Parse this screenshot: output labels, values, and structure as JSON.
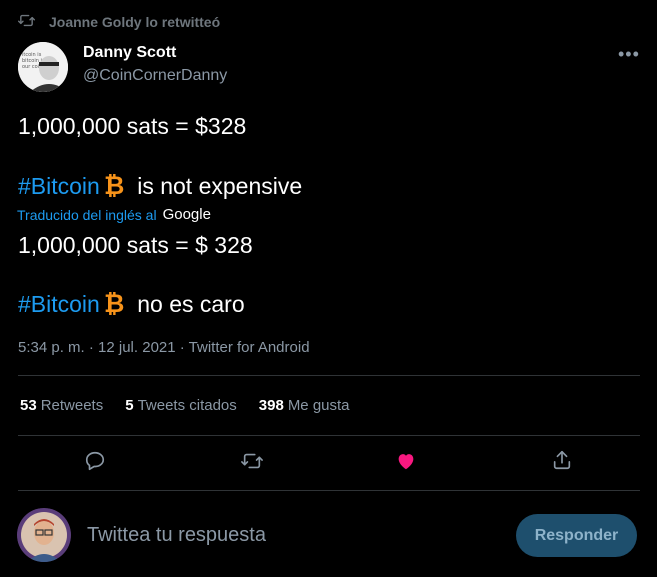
{
  "retweet": {
    "text": "Joanne Goldy lo retwitteó"
  },
  "author": {
    "name": "Danny Scott",
    "handle": "@CoinCornerDanny"
  },
  "tweet": {
    "line1": "1,000,000 sats = $328",
    "line2_hashtag": "#Bitcoin",
    "line2_rest": "is not expensive",
    "translated_label": "Traducido del inglés al",
    "translated_brand": "Google",
    "line3": "1,000,000 sats = $ 328",
    "line4_hashtag": "#Bitcoin",
    "line4_rest": "no es caro",
    "meta": "5:34 p. m. · 12 jul. 2021 · Twitter for Android"
  },
  "stats": {
    "retweets_count": "53",
    "retweets_label": "Retweets",
    "quotes_count": "5",
    "quotes_label": "Tweets citados",
    "likes_count": "398",
    "likes_label": "Me gusta"
  },
  "reply": {
    "placeholder": "Twittea tu respuesta",
    "button_label": "Responder"
  },
  "colors": {
    "accent": "#1d9bf0",
    "like": "#f91880",
    "bitcoin": "#f7931a"
  },
  "icons": [
    "retweet-icon",
    "more-icon",
    "bitcoin-icon",
    "reply-icon",
    "retweet-action-icon",
    "like-icon",
    "share-icon"
  ]
}
